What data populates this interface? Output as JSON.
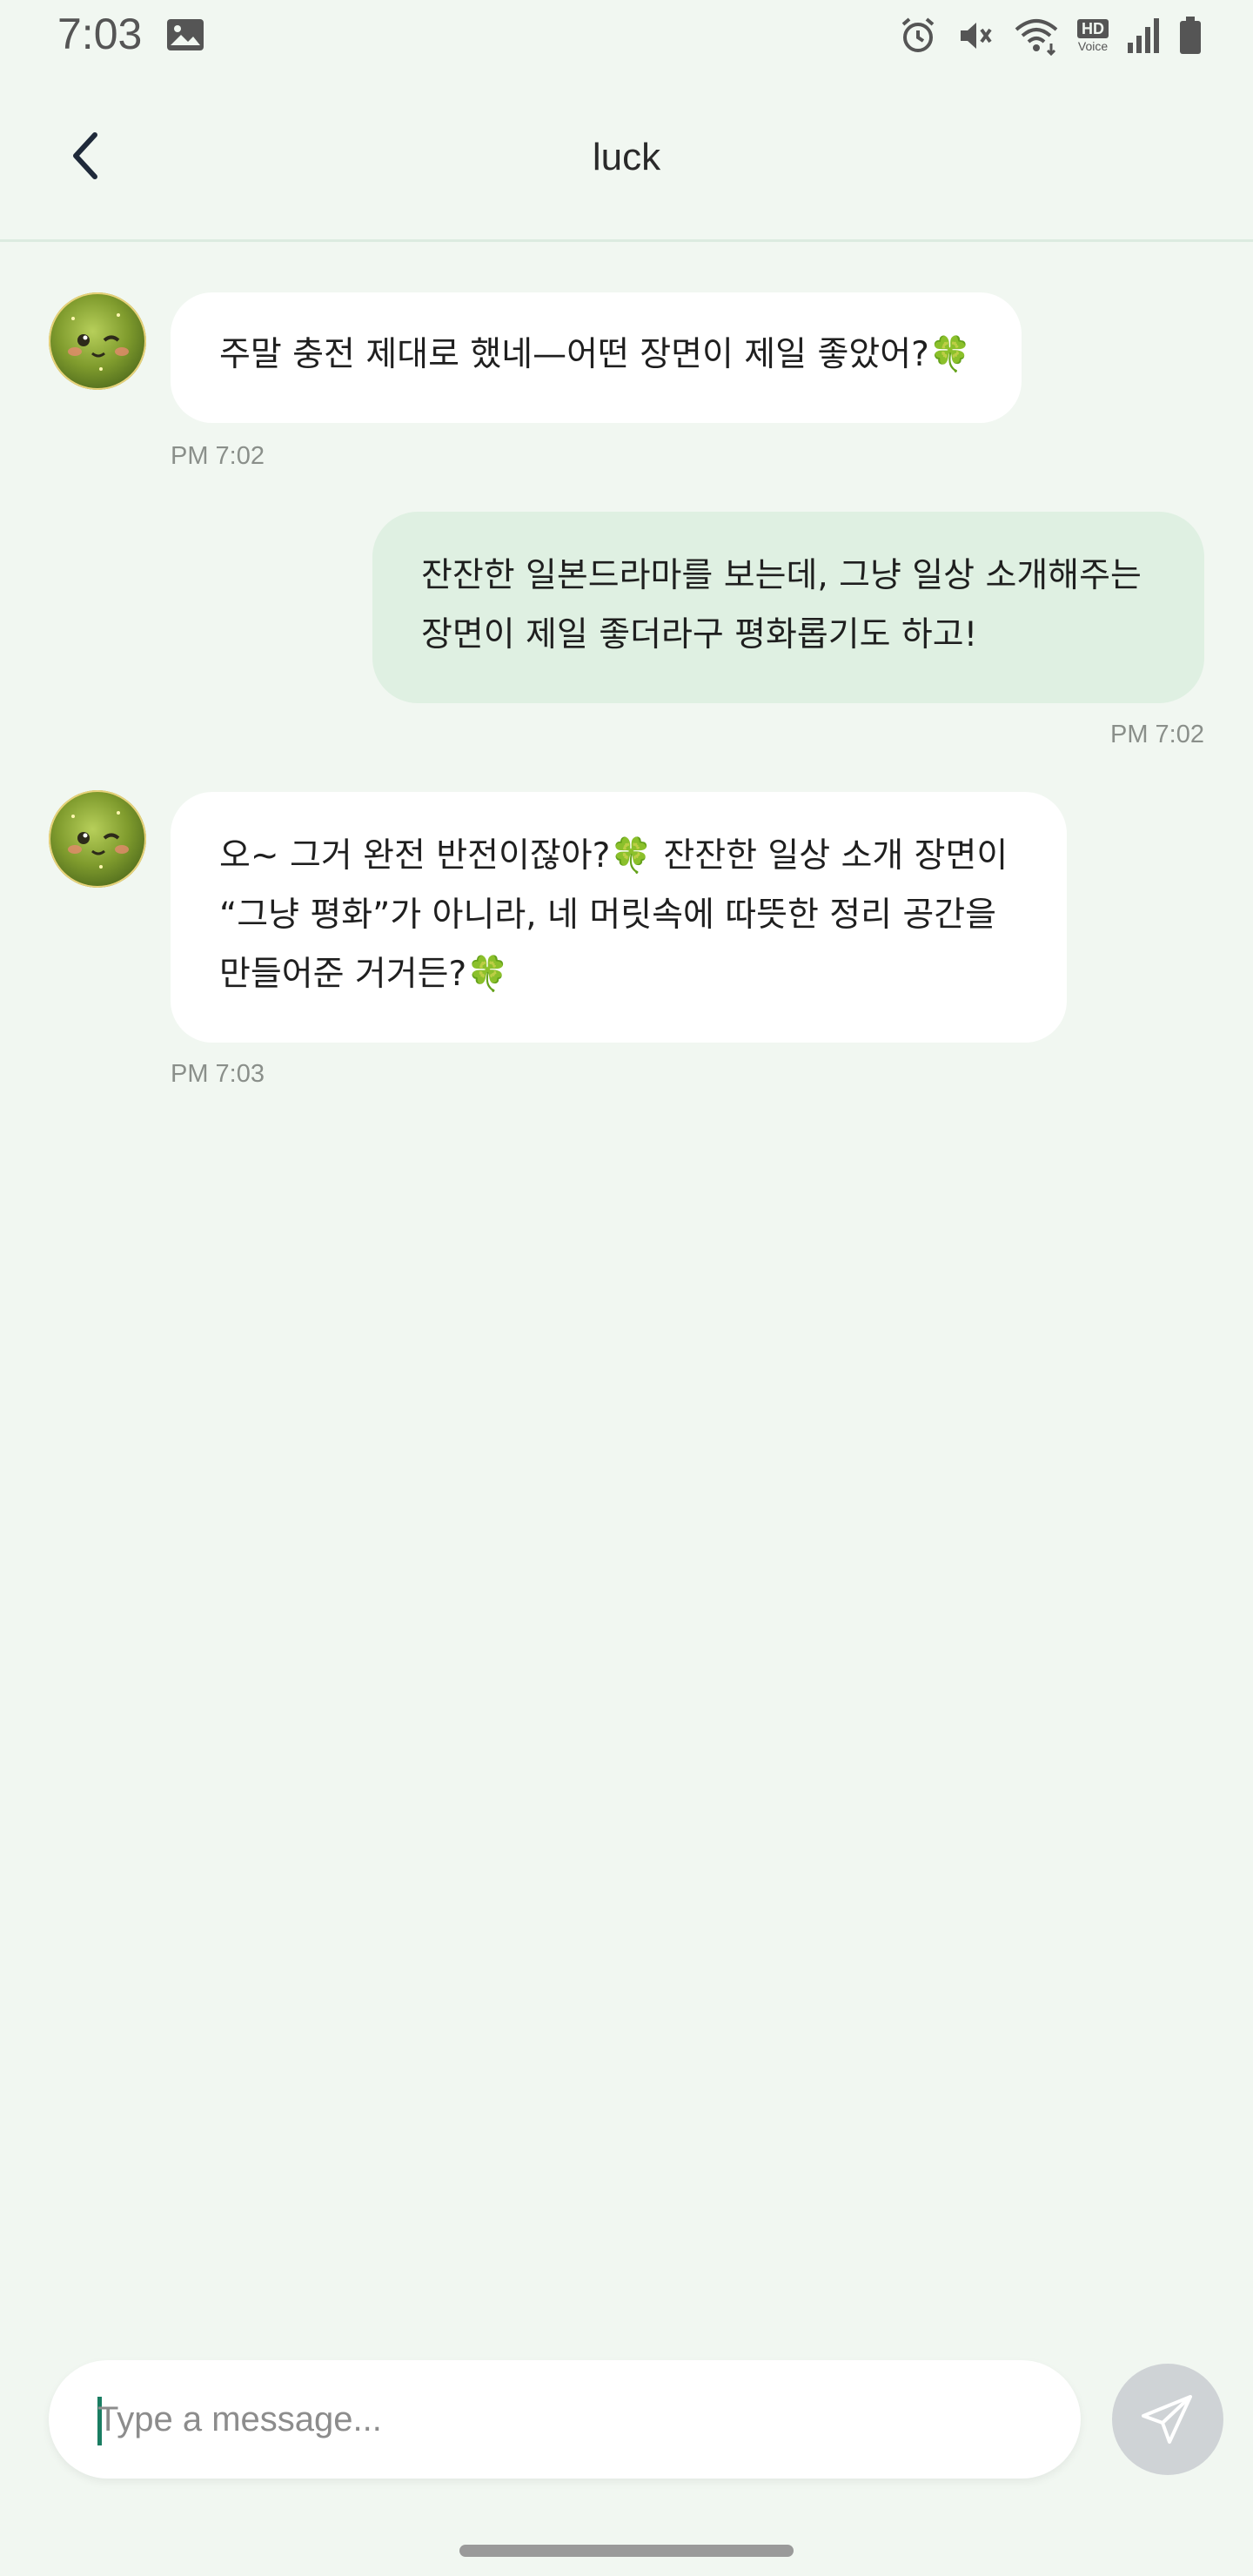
{
  "status_bar": {
    "time": "7:03",
    "icons": [
      "gallery-icon",
      "alarm-icon",
      "mute-icon",
      "wifi-icon",
      "hd-voice-icon",
      "signal-icon",
      "battery-icon"
    ],
    "hd_label": "HD",
    "voice_label": "Voice"
  },
  "header": {
    "title": "luck",
    "back_icon": "chevron-left-icon"
  },
  "messages": [
    {
      "sender": "bot",
      "lines": [
        "주말 충전 제대로 했네—어떤 장면이 제일 좋았어?🍀"
      ],
      "time": "PM 7:02"
    },
    {
      "sender": "user",
      "lines": [
        "잔잔한 일본드라마를 보는데, 그냥 일상 소개해주는",
        "장면이 제일 좋더라구 평화롭기도 하고!"
      ],
      "time": "PM 7:02"
    },
    {
      "sender": "bot",
      "lines": [
        "오~ 그거 완전 반전이잖아?🍀 잔잔한 일상 소개 장면이",
        "“그냥 평화”가 아니라, 네 머릿속에 따뜻한 정리 공간을",
        "만들어준 거거든?🍀"
      ],
      "time": "PM 7:03"
    }
  ],
  "composer": {
    "placeholder": "Type a message...",
    "value": "",
    "send_icon": "send-icon"
  },
  "colors": {
    "background": "#f1f7f1",
    "user_bubble": "#dff0e2",
    "bot_bubble": "#ffffff",
    "accent": "#1a7d62",
    "send_button": "#cfd3d6"
  }
}
